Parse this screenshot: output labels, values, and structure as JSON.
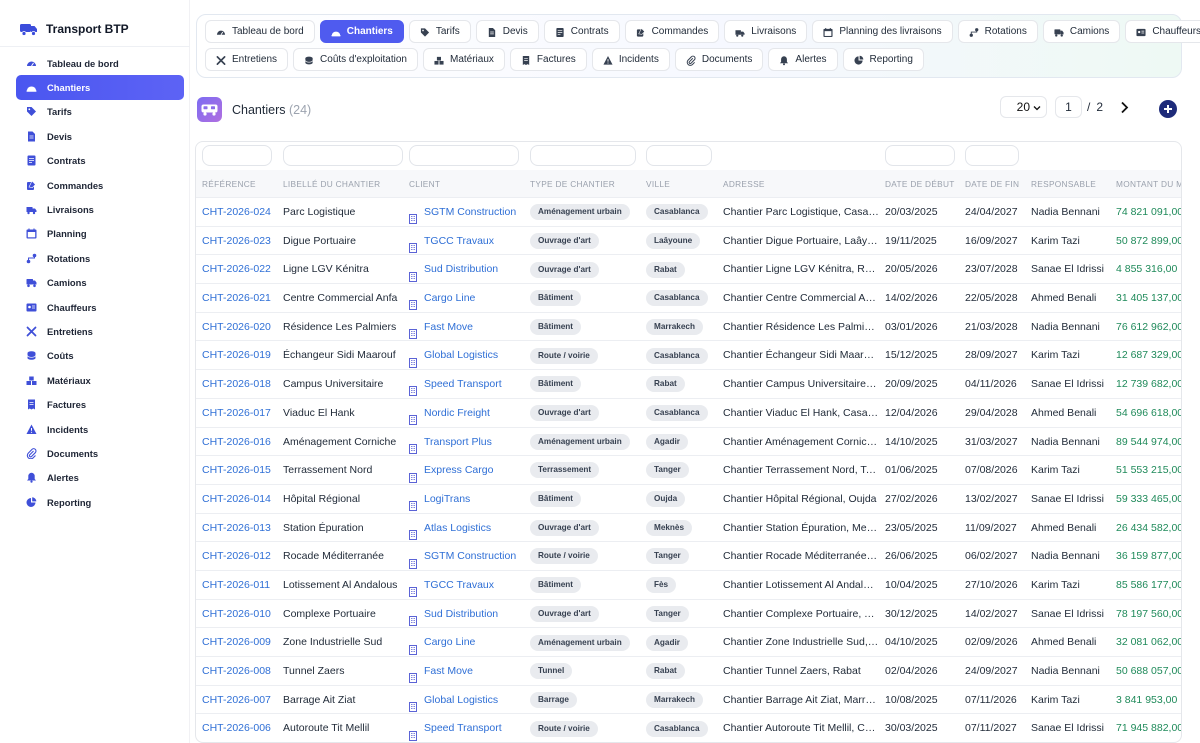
{
  "app": {
    "title": "Transport BTP",
    "accent": "#4f5bef"
  },
  "sidebar": {
    "items": [
      {
        "label": "Tableau de bord",
        "icon": "dashboard-icon"
      },
      {
        "label": "Chantiers",
        "icon": "helmet-icon",
        "active": true
      },
      {
        "label": "Tarifs",
        "icon": "tag-icon"
      },
      {
        "label": "Devis",
        "icon": "document-icon"
      },
      {
        "label": "Contrats",
        "icon": "contract-icon"
      },
      {
        "label": "Commandes",
        "icon": "order-icon"
      },
      {
        "label": "Livraisons",
        "icon": "delivery-icon"
      },
      {
        "label": "Planning",
        "icon": "calendar-icon"
      },
      {
        "label": "Rotations",
        "icon": "route-icon"
      },
      {
        "label": "Camions",
        "icon": "truck-icon"
      },
      {
        "label": "Chauffeurs",
        "icon": "id-card-icon"
      },
      {
        "label": "Entretiens",
        "icon": "tools-icon"
      },
      {
        "label": "Coûts",
        "icon": "coins-icon"
      },
      {
        "label": "Matériaux",
        "icon": "materials-icon"
      },
      {
        "label": "Factures",
        "icon": "invoice-icon"
      },
      {
        "label": "Incidents",
        "icon": "warning-icon"
      },
      {
        "label": "Documents",
        "icon": "paperclip-icon"
      },
      {
        "label": "Alertes",
        "icon": "bell-icon"
      },
      {
        "label": "Reporting",
        "icon": "chart-icon"
      }
    ]
  },
  "tabs": {
    "row1": [
      {
        "label": "Tableau de bord",
        "icon": "dashboard-icon"
      },
      {
        "label": "Chantiers",
        "icon": "helmet-icon",
        "active": true
      },
      {
        "label": "Tarifs",
        "icon": "tag-icon"
      },
      {
        "label": "Devis",
        "icon": "document-icon"
      },
      {
        "label": "Contrats",
        "icon": "contract-icon"
      },
      {
        "label": "Commandes",
        "icon": "order-icon"
      },
      {
        "label": "Livraisons",
        "icon": "delivery-icon"
      },
      {
        "label": "Planning des livraisons",
        "icon": "calendar-icon"
      },
      {
        "label": "Rotations",
        "icon": "route-icon"
      },
      {
        "label": "Camions",
        "icon": "truck-icon"
      },
      {
        "label": "Chauffeurs",
        "icon": "id-card-icon"
      }
    ],
    "row2": [
      {
        "label": "Entretiens",
        "icon": "tools-icon"
      },
      {
        "label": "Coûts d'exploitation",
        "icon": "coins-icon"
      },
      {
        "label": "Matériaux",
        "icon": "materials-icon"
      },
      {
        "label": "Factures",
        "icon": "invoice-icon"
      },
      {
        "label": "Incidents",
        "icon": "warning-icon"
      },
      {
        "label": "Documents",
        "icon": "paperclip-icon"
      },
      {
        "label": "Alertes",
        "icon": "bell-icon"
      },
      {
        "label": "Reporting",
        "icon": "chart-icon"
      }
    ]
  },
  "page": {
    "title": "Chantiers",
    "count": "(24)"
  },
  "pager": {
    "page_size": "20",
    "current_page": "1",
    "separator": "/",
    "total_pages": "2"
  },
  "table": {
    "columns": [
      "RÉFÉRENCE",
      "LIBELLÉ DU CHANTIER",
      "CLIENT",
      "TYPE DE CHANTIER",
      "VILLE",
      "ADRESSE",
      "DATE DE DÉBUT",
      "DATE DE FIN",
      "RESPONSABLE",
      "MONTANT DU M"
    ],
    "rows": [
      [
        "CHT-2026-024",
        "Parc Logistique",
        "SGTM Construction",
        "Aménagement urbain",
        "Casablanca",
        "Chantier Parc Logistique, Casablanca",
        "20/03/2025",
        "24/04/2027",
        "Nadia Bennani",
        "74 821 091,00"
      ],
      [
        "CHT-2026-023",
        "Digue Portuaire",
        "TGCC Travaux",
        "Ouvrage d'art",
        "Laâyoune",
        "Chantier Digue Portuaire, Laâyoune",
        "19/11/2025",
        "16/09/2027",
        "Karim Tazi",
        "50 872 899,00"
      ],
      [
        "CHT-2026-022",
        "Ligne LGV Kénitra",
        "Sud Distribution",
        "Ouvrage d'art",
        "Rabat",
        "Chantier Ligne LGV Kénitra, Rabat",
        "20/05/2026",
        "23/07/2028",
        "Sanae El Idrissi",
        "4 855 316,00"
      ],
      [
        "CHT-2026-021",
        "Centre Commercial Anfa",
        "Cargo Line",
        "Bâtiment",
        "Casablanca",
        "Chantier Centre Commercial Anfa, Casablanca",
        "14/02/2026",
        "22/05/2028",
        "Ahmed Benali",
        "31 405 137,00"
      ],
      [
        "CHT-2026-020",
        "Résidence Les Palmiers",
        "Fast Move",
        "Bâtiment",
        "Marrakech",
        "Chantier Résidence Les Palmiers, Marrakech",
        "03/01/2026",
        "21/03/2028",
        "Nadia Bennani",
        "76 612 962,00"
      ],
      [
        "CHT-2026-019",
        "Échangeur Sidi Maarouf",
        "Global Logistics",
        "Route / voirie",
        "Casablanca",
        "Chantier Échangeur Sidi Maarouf, Casablanca",
        "15/12/2025",
        "28/09/2027",
        "Karim Tazi",
        "12 687 329,00"
      ],
      [
        "CHT-2026-018",
        "Campus Universitaire",
        "Speed Transport",
        "Bâtiment",
        "Rabat",
        "Chantier Campus Universitaire, Rabat",
        "20/09/2025",
        "04/11/2026",
        "Sanae El Idrissi",
        "12 739 682,00"
      ],
      [
        "CHT-2026-017",
        "Viaduc El Hank",
        "Nordic Freight",
        "Ouvrage d'art",
        "Casablanca",
        "Chantier Viaduc El Hank, Casablanca",
        "12/04/2026",
        "29/04/2028",
        "Ahmed Benali",
        "54 696 618,00"
      ],
      [
        "CHT-2026-016",
        "Aménagement Corniche",
        "Transport Plus",
        "Aménagement urbain",
        "Agadir",
        "Chantier Aménagement Corniche, Agadir",
        "14/10/2025",
        "31/03/2027",
        "Nadia Bennani",
        "89 544 974,00"
      ],
      [
        "CHT-2026-015",
        "Terrassement Nord",
        "Express Cargo",
        "Terrassement",
        "Tanger",
        "Chantier Terrassement Nord, Tanger",
        "01/06/2025",
        "07/08/2026",
        "Karim Tazi",
        "51 553 215,00"
      ],
      [
        "CHT-2026-014",
        "Hôpital Régional",
        "LogiTrans",
        "Bâtiment",
        "Oujda",
        "Chantier Hôpital Régional, Oujda",
        "27/02/2026",
        "13/02/2027",
        "Sanae El Idrissi",
        "59 333 465,00"
      ],
      [
        "CHT-2026-013",
        "Station Épuration",
        "Atlas Logistics",
        "Ouvrage d'art",
        "Meknès",
        "Chantier Station Épuration, Meknès",
        "23/05/2025",
        "11/09/2027",
        "Ahmed Benali",
        "26 434 582,00"
      ],
      [
        "CHT-2026-012",
        "Rocade Méditerranée",
        "SGTM Construction",
        "Route / voirie",
        "Tanger",
        "Chantier Rocade Méditerranée, Tanger",
        "26/06/2025",
        "06/02/2027",
        "Nadia Bennani",
        "36 159 877,00"
      ],
      [
        "CHT-2026-011",
        "Lotissement Al Andalous",
        "TGCC Travaux",
        "Bâtiment",
        "Fès",
        "Chantier Lotissement Al Andalous, Fès",
        "10/04/2025",
        "27/10/2026",
        "Karim Tazi",
        "85 586 177,00"
      ],
      [
        "CHT-2026-010",
        "Complexe Portuaire",
        "Sud Distribution",
        "Ouvrage d'art",
        "Tanger",
        "Chantier Complexe Portuaire, Tanger",
        "30/12/2025",
        "14/02/2027",
        "Sanae El Idrissi",
        "78 197 560,00"
      ],
      [
        "CHT-2026-009",
        "Zone Industrielle Sud",
        "Cargo Line",
        "Aménagement urbain",
        "Agadir",
        "Chantier Zone Industrielle Sud, Agadir",
        "04/10/2025",
        "02/09/2026",
        "Ahmed Benali",
        "32 081 062,00"
      ],
      [
        "CHT-2026-008",
        "Tunnel Zaers",
        "Fast Move",
        "Tunnel",
        "Rabat",
        "Chantier Tunnel Zaers, Rabat",
        "02/04/2026",
        "24/09/2027",
        "Nadia Bennani",
        "50 688 057,00"
      ],
      [
        "CHT-2026-007",
        "Barrage Ait Ziat",
        "Global Logistics",
        "Barrage",
        "Marrakech",
        "Chantier Barrage Ait Ziat, Marrakech",
        "10/08/2025",
        "07/11/2026",
        "Karim Tazi",
        "3 841 953,00"
      ],
      [
        "CHT-2026-006",
        "Autoroute Tit Mellil",
        "Speed Transport",
        "Route / voirie",
        "Casablanca",
        "Chantier Autoroute Tit Mellil, Casablanca",
        "30/03/2025",
        "07/11/2027",
        "Sanae El Idrissi",
        "71 945 882,00"
      ]
    ]
  }
}
